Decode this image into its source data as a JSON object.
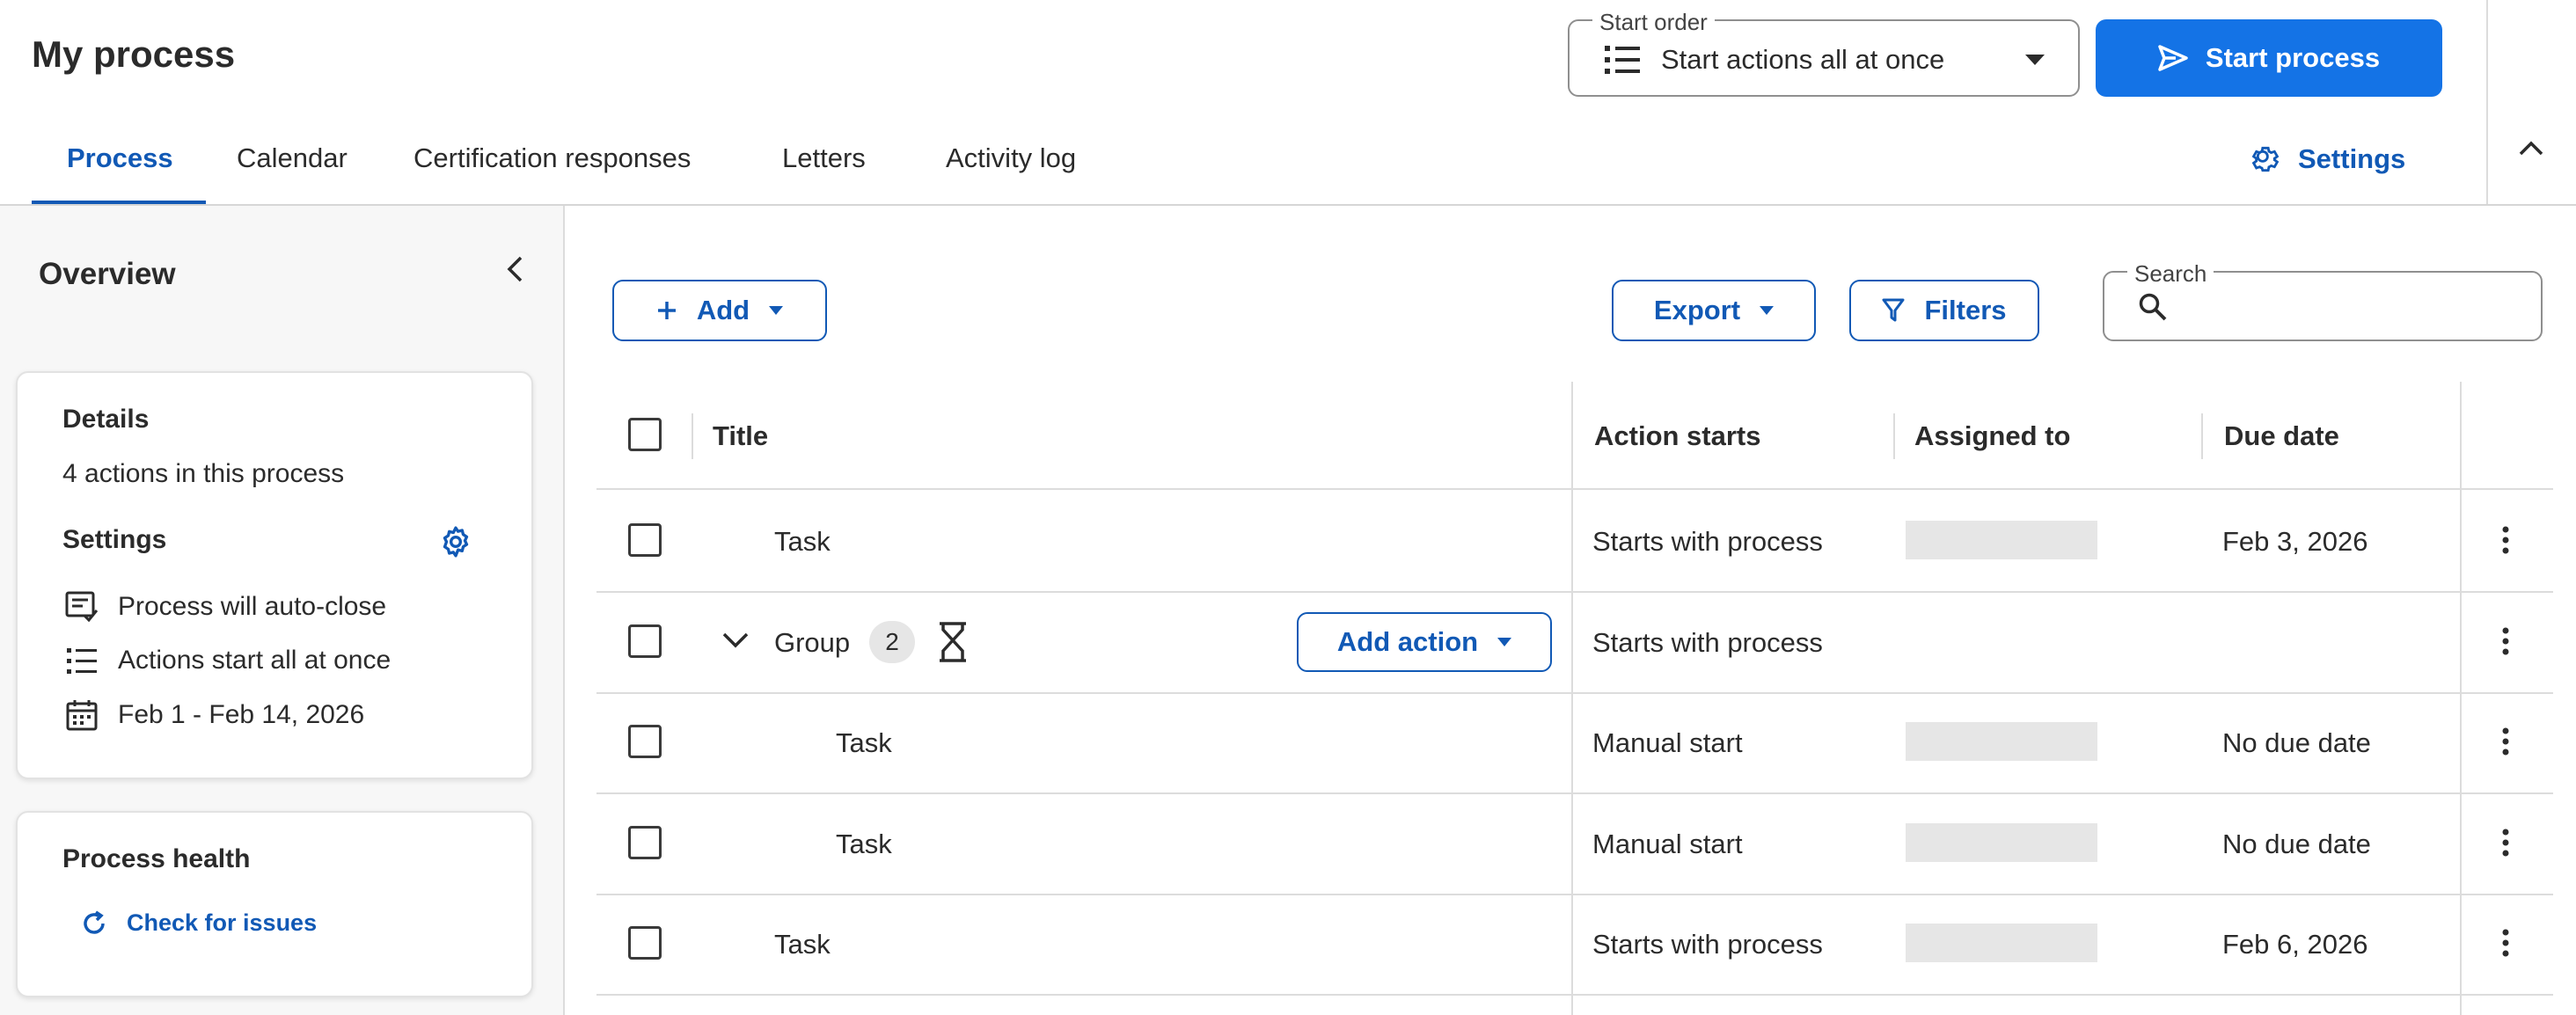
{
  "header": {
    "title": "My process",
    "start_order": {
      "legend": "Start order",
      "value": "Start actions all at once"
    },
    "start_button": "Start process",
    "tabs": [
      {
        "label": "Process",
        "active": true
      },
      {
        "label": "Calendar",
        "active": false
      },
      {
        "label": "Certification responses",
        "active": false
      },
      {
        "label": "Letters",
        "active": false
      },
      {
        "label": "Activity log",
        "active": false
      }
    ],
    "settings_link": "Settings"
  },
  "sidebar": {
    "title": "Overview",
    "details": {
      "heading": "Details",
      "summary": "4 actions in this process",
      "settings_heading": "Settings",
      "items": [
        {
          "icon": "auto-close-icon",
          "label": "Process will auto-close"
        },
        {
          "icon": "list-icon",
          "label": "Actions start all at once"
        },
        {
          "icon": "calendar-icon",
          "label": "Feb 1 - Feb 14, 2026"
        }
      ]
    },
    "health": {
      "heading": "Process health",
      "link": "Check for issues"
    }
  },
  "toolbar": {
    "add_label": "Add",
    "export_label": "Export",
    "filters_label": "Filters",
    "search_legend": "Search",
    "search_value": ""
  },
  "table": {
    "columns": [
      "Title",
      "Action starts",
      "Assigned to",
      "Due date"
    ],
    "rows": [
      {
        "title": "Task",
        "starts": "Starts with process",
        "due": "Feb 3, 2026"
      },
      {
        "title": "Group",
        "count": "2",
        "starts": "Starts with process",
        "due": "",
        "add_action": "Add action"
      },
      {
        "title": "Task",
        "starts": "Manual start",
        "due": "No due date"
      },
      {
        "title": "Task",
        "starts": "Manual start",
        "due": "No due date"
      },
      {
        "title": "Task",
        "starts": "Starts with process",
        "due": "Feb 6, 2026"
      }
    ]
  },
  "colors": {
    "accent": "#1159b5",
    "primary_button": "#1473e6",
    "border": "#dcdcdc",
    "sidebar_bg": "#f7f7f7",
    "placeholder": "#e6e6e6"
  }
}
